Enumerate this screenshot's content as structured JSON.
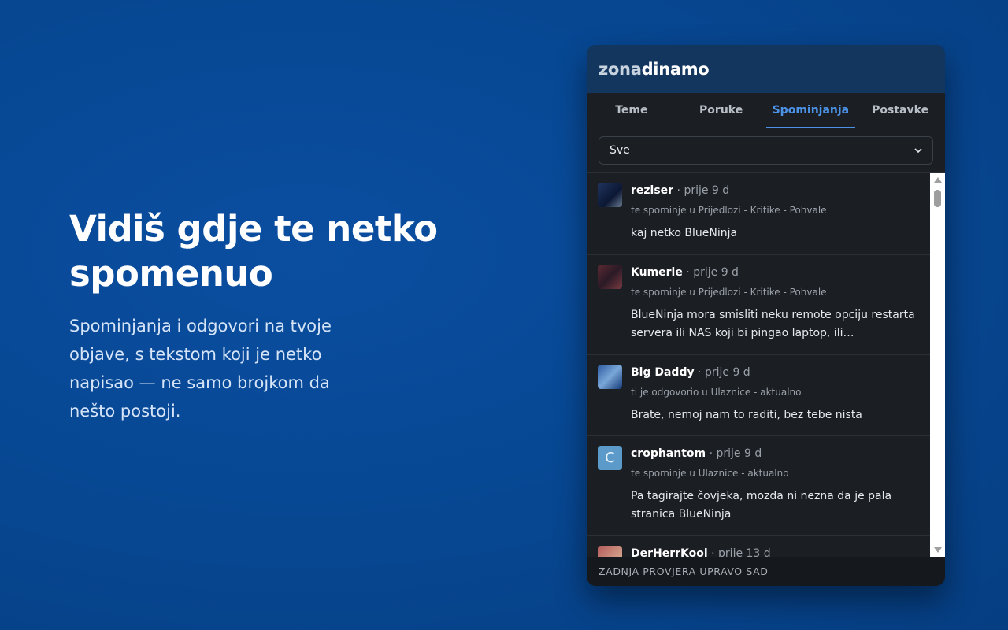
{
  "hero": {
    "title": "Vidiš gdje te netko spomenuo",
    "description": "Spominjanja i odgovori na tvoje objave, s tekstom koji je netko napisao — ne samo brojkom da nešto postoji."
  },
  "panel": {
    "logo": {
      "part1": "zona",
      "part2": "dinamo"
    },
    "tabs": [
      {
        "label": "Teme"
      },
      {
        "label": "Poruke"
      },
      {
        "label": "Spominjanja",
        "active": true
      },
      {
        "label": "Postavke"
      }
    ],
    "filter": {
      "selected": "Sve"
    },
    "items": [
      {
        "username": "reziser",
        "time": " · prije 9 d",
        "context": "te spominje u Prijedlozi - Kritike - Pohvale",
        "text": "kaj netko BlueNinja",
        "avatar": "reziser-avatar"
      },
      {
        "username": "Kumerle",
        "time": " · prije 9 d",
        "context": "te spominje u Prijedlozi - Kritike - Pohvale",
        "text": "BlueNinja mora smisliti neku remote opciju restarta servera ili NAS koji bi pingao laptop, ili…",
        "avatar": "kumerle-avatar"
      },
      {
        "username": "Big Daddy",
        "time": " · prije 9 d",
        "context": "ti je odgovorio u Ulaznice - aktualno",
        "text": "Brate, nemoj nam to raditi, bez tebe nista",
        "avatar": "bigdaddy-avatar"
      },
      {
        "username": "crophantom",
        "time": " · prije 9 d",
        "context": "te spominje u Ulaznice - aktualno",
        "text": "Pa tagirajte čovjeka, mozda ni nezna da je pala stranica BlueNinja",
        "avatar_letter": "C"
      },
      {
        "username": "DerHerrKool",
        "time": " · prije 13 d",
        "context": "",
        "text": "",
        "avatar": "derherrkool-avatar"
      }
    ],
    "footer": "ZADNJA PROVJERA UPRAVO SAD"
  },
  "colors": {
    "background": "#074894",
    "panel": "#1b1f24",
    "header": "#13365f",
    "accent": "#4c93e8"
  }
}
